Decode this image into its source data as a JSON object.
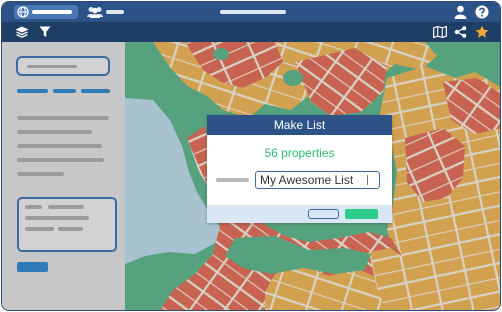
{
  "topbar": {
    "icons": [
      "globe-icon",
      "users-icon",
      "user-icon",
      "help-icon"
    ]
  },
  "toolbar": {
    "icons": [
      "layers-icon",
      "filter-icon",
      "map-icon",
      "share-icon",
      "star-icon"
    ],
    "star_color": "#f0a830"
  },
  "map": {
    "colors": {
      "water": "#a8c2cf",
      "park": "#56a17e",
      "parcel_orange": "#d2a14f",
      "parcel_red": "#c76350",
      "road": "#d8d2c4"
    }
  },
  "modal": {
    "title": "Make List",
    "count_text": "56 properties",
    "name_value": "My Awesome List"
  },
  "colors": {
    "header": "#2d5288",
    "toolbar": "#1f3e66",
    "accent": "#2e7bb7",
    "success": "#2fbc72"
  }
}
